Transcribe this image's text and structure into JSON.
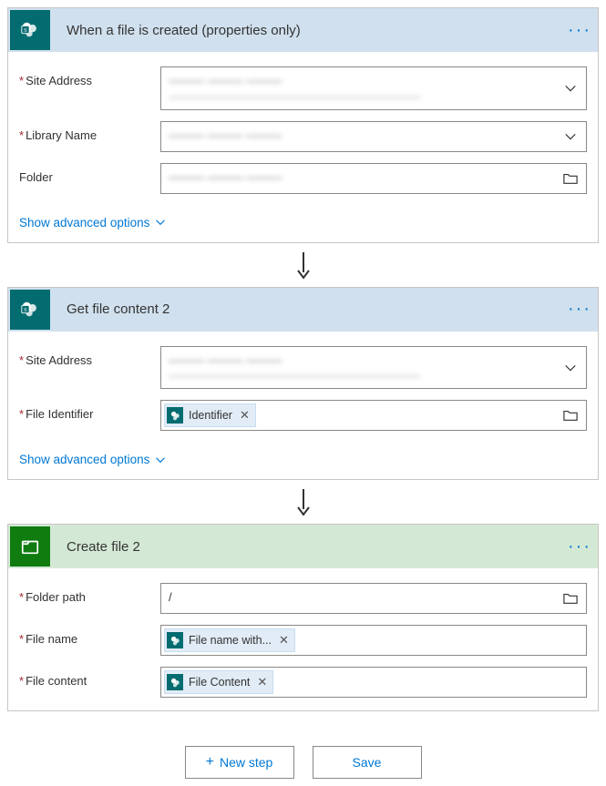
{
  "step1": {
    "title": "When a file is created (properties only)",
    "fields": {
      "siteAddress": {
        "label": "Site Address",
        "required": true,
        "line1": "——— ——— ———",
        "line2": "———————————————————————"
      },
      "libraryName": {
        "label": "Library Name",
        "required": true,
        "line1": "——— ——— ———",
        "line2": ""
      },
      "folder": {
        "label": "Folder",
        "required": false,
        "line1": "——— ——— ———"
      }
    },
    "advanced": "Show advanced options"
  },
  "step2": {
    "title": "Get file content 2",
    "fields": {
      "siteAddress": {
        "label": "Site Address",
        "required": true,
        "line1": "——— ——— ———",
        "line2": "———————————————————————"
      },
      "fileIdentifier": {
        "label": "File Identifier",
        "required": true,
        "token": "Identifier"
      }
    },
    "advanced": "Show advanced options"
  },
  "step3": {
    "title": "Create file 2",
    "fields": {
      "folderPath": {
        "label": "Folder path",
        "required": true,
        "value": "/"
      },
      "fileName": {
        "label": "File name",
        "required": true,
        "token": "File name with..."
      },
      "fileContent": {
        "label": "File content",
        "required": true,
        "token": "File Content"
      }
    }
  },
  "footer": {
    "newStep": "New step",
    "save": "Save"
  },
  "icons": {
    "menu": "···"
  }
}
